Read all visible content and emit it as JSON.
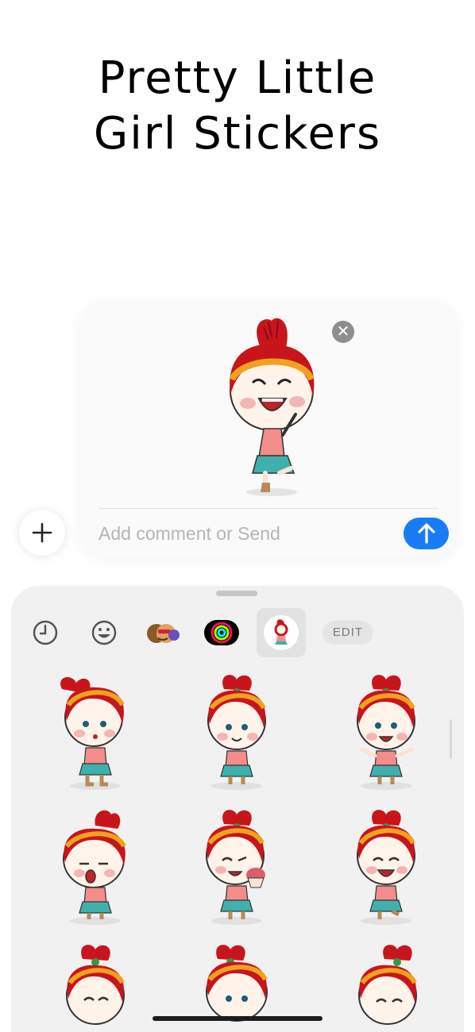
{
  "headline": {
    "line1": "Pretty Little",
    "line2": "Girl Stickers"
  },
  "compose": {
    "comment_placeholder": "Add comment or Send",
    "close_icon": "close-icon",
    "send_icon": "arrow-up-icon"
  },
  "drawer": {
    "tabs": [
      {
        "name": "recents",
        "icon": "clock-icon"
      },
      {
        "name": "emoji",
        "icon": "smiley-icon"
      },
      {
        "name": "memoji",
        "icon": "memoji-icon"
      },
      {
        "name": "activity",
        "icon": "activity-rings-icon"
      },
      {
        "name": "girl-stickers",
        "icon": "girl-sticker-icon",
        "selected": true
      }
    ],
    "edit_label": "EDIT",
    "stickers": [
      "shy",
      "smile",
      "wave",
      "yawn",
      "cupcake",
      "laugh",
      "blush",
      "shout",
      "wink"
    ]
  },
  "colors": {
    "accent": "#1a7cf5",
    "hair": "#c8151b",
    "headband": "#f0a21e",
    "shirt": "#f28d8b",
    "skirt": "#3fb1ad",
    "drawer_bg": "#f1f1f1"
  }
}
